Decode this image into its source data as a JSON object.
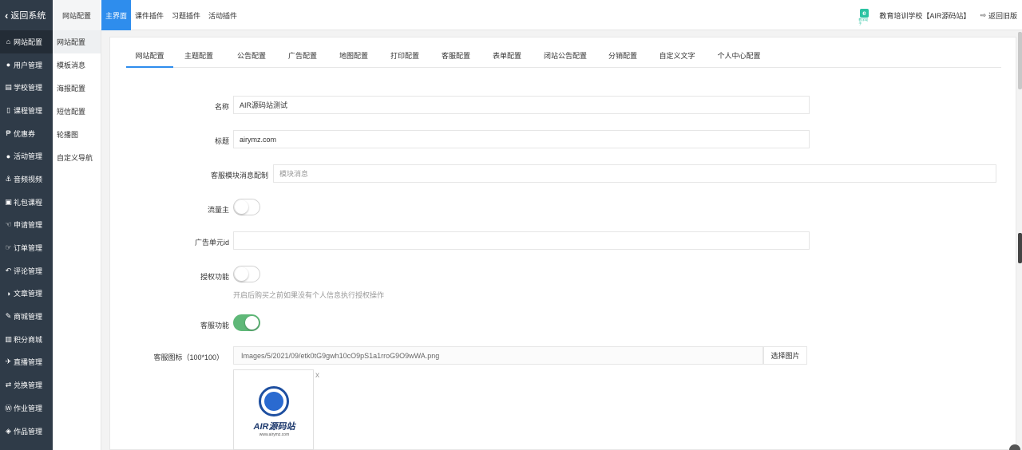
{
  "topbar": {
    "back_label": "返回系统",
    "site_config_label": "网站配置",
    "menu": [
      "主界面",
      "课件插件",
      "习题插件",
      "活动插件"
    ],
    "school_logo_text": "e",
    "school_logo_sub": "教学助手",
    "school_name": "教育培训学校【AIR源码站】",
    "return_old_label": "返回旧版"
  },
  "sidebar": {
    "items": [
      {
        "icon": "home-icon",
        "glyph": "⌂",
        "label": "网站配置"
      },
      {
        "icon": "user-icon",
        "glyph": "●",
        "label": "用户管理"
      },
      {
        "icon": "school-icon",
        "glyph": "▤",
        "label": "学校管理"
      },
      {
        "icon": "cart-icon",
        "glyph": "▯",
        "label": "课程管理"
      },
      {
        "icon": "coupon-icon",
        "glyph": "₱",
        "label": "优惠券"
      },
      {
        "icon": "users-icon",
        "glyph": "●",
        "label": "活动管理"
      },
      {
        "icon": "anchor-icon",
        "glyph": "⚓",
        "label": "音频视频"
      },
      {
        "icon": "gift-icon",
        "glyph": "▣",
        "label": "礼包课程"
      },
      {
        "icon": "hand-icon",
        "glyph": "☜",
        "label": "申请管理"
      },
      {
        "icon": "thumb-icon",
        "glyph": "☞",
        "label": "订单管理"
      },
      {
        "icon": "reply-icon",
        "glyph": "↶",
        "label": "评论管理"
      },
      {
        "icon": "contrast-icon",
        "glyph": "◑",
        "label": "文章管理"
      },
      {
        "icon": "wand-icon",
        "glyph": "✎",
        "label": "商城管理"
      },
      {
        "icon": "book-icon",
        "glyph": "▥",
        "label": "积分商城"
      },
      {
        "icon": "plane-icon",
        "glyph": "✈",
        "label": "直播管理"
      },
      {
        "icon": "exchange-icon",
        "glyph": "⇄",
        "label": "兑换管理"
      },
      {
        "icon": "wordpress-icon",
        "glyph": "Ⓦ",
        "label": "作业管理"
      },
      {
        "icon": "cube-icon",
        "glyph": "◈",
        "label": "作品管理"
      }
    ]
  },
  "subnav": {
    "items": [
      "网站配置",
      "模板消息",
      "海报配置",
      "短信配置",
      "轮播图",
      "自定义导航"
    ]
  },
  "tabs": [
    "网站配置",
    "主题配置",
    "公告配置",
    "广告配置",
    "地图配置",
    "打印配置",
    "客服配置",
    "表单配置",
    "闭站公告配置",
    "分销配置",
    "自定义文字",
    "个人中心配置"
  ],
  "form": {
    "name_label": "名称",
    "name_value": "AIR源码站测试",
    "title_label": "标题",
    "title_value": "airymz.com",
    "kefu_msg_label": "客服模块消息配制",
    "kefu_msg_placeholder": "模块消息",
    "traffic_label": "流量主",
    "traffic_on": false,
    "ad_unit_label": "广告单元id",
    "ad_unit_value": "",
    "auth_label": "授权功能",
    "auth_on": false,
    "auth_hint": "开启后购买之前如果没有个人信息执行授权操作",
    "kefu_label": "客服功能",
    "kefu_on": true,
    "kefu_icon_label": "客服图标（100*100）",
    "kefu_icon_path": "Images/5/2021/09/etk0tG9gwh10cO9pS1a1rroG9O9wWA.png",
    "choose_image_label": "选择图片",
    "remove_label": "x",
    "thumb_logo_text": "AIR源码站",
    "thumb_logo_sub": "www.airymz.com"
  },
  "colors": {
    "sidebar_bg": "#2f3b48",
    "accent": "#2e8ded",
    "switch_on": "#5fb878"
  }
}
